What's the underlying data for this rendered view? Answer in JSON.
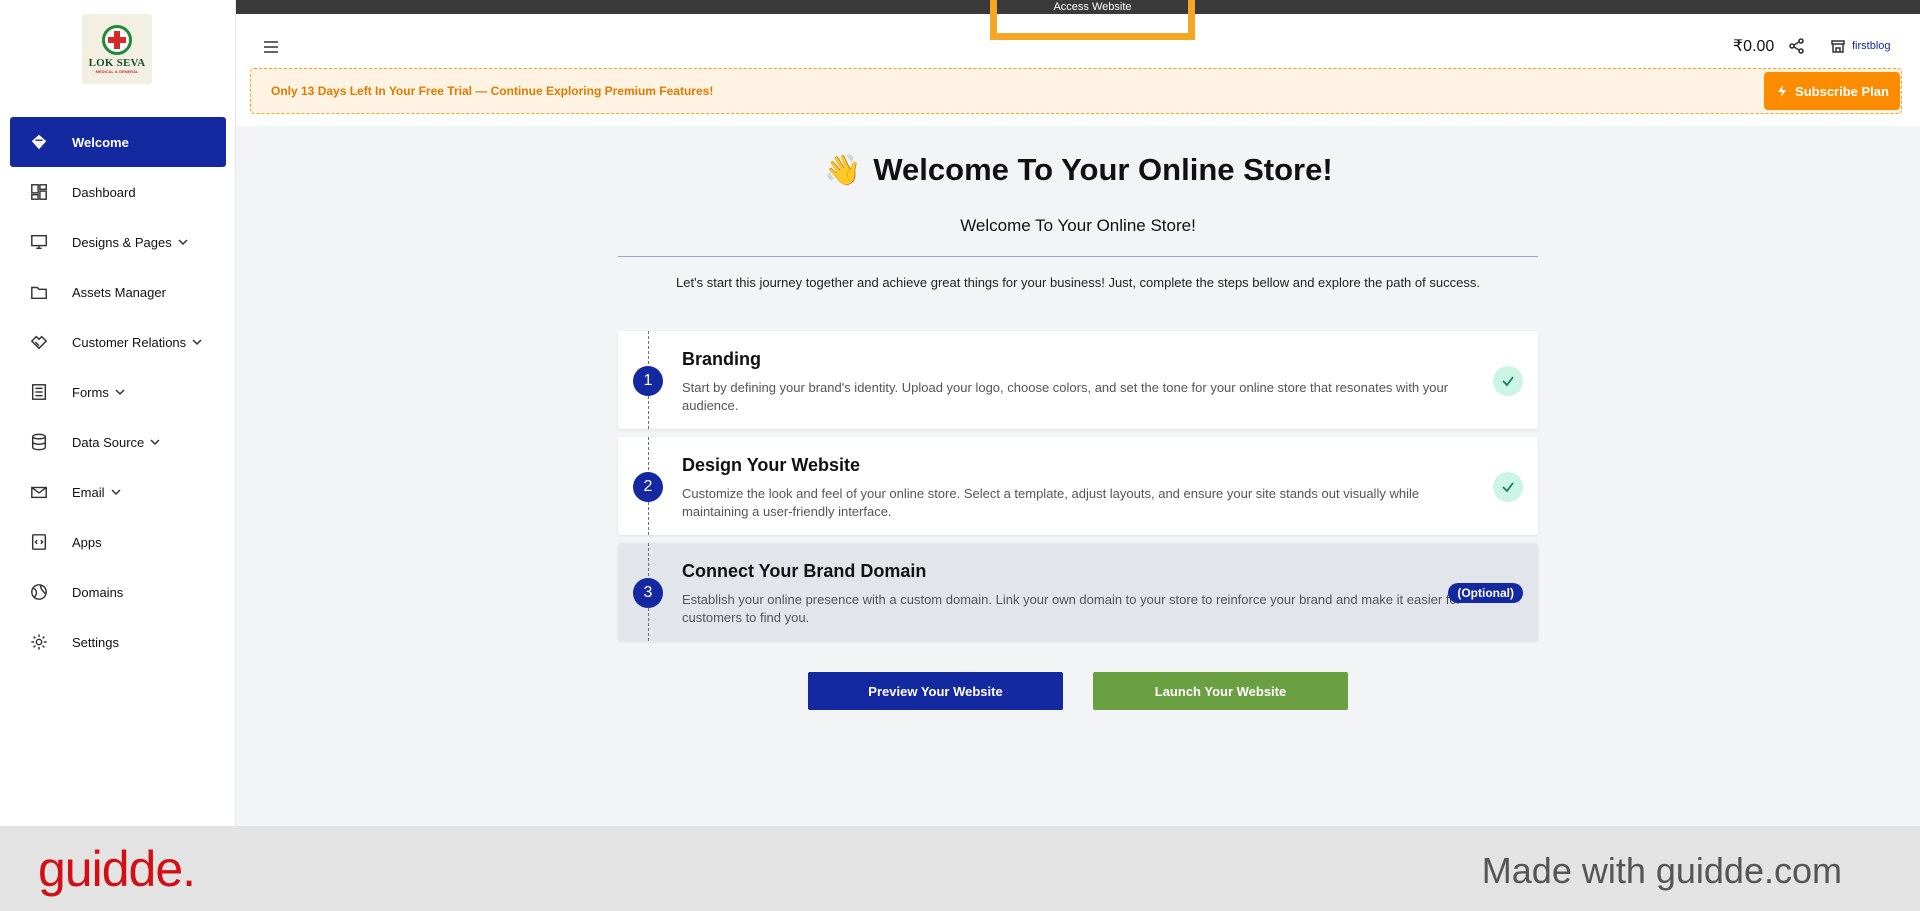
{
  "brand": {
    "logo_text": "LOK SEVA",
    "logo_subtext": "MEDICAL & GENERAL"
  },
  "sidebar": {
    "items": [
      {
        "label": "Welcome",
        "icon": "diamond-icon",
        "active": true,
        "has_chevron": false
      },
      {
        "label": "Dashboard",
        "icon": "dashboard-icon",
        "active": false,
        "has_chevron": false
      },
      {
        "label": "Designs & Pages",
        "icon": "monitor-icon",
        "active": false,
        "has_chevron": true
      },
      {
        "label": "Assets Manager",
        "icon": "folder-icon",
        "active": false,
        "has_chevron": false
      },
      {
        "label": "Customer Relations",
        "icon": "handshake-icon",
        "active": false,
        "has_chevron": true
      },
      {
        "label": "Forms",
        "icon": "form-icon",
        "active": false,
        "has_chevron": true
      },
      {
        "label": "Data Source",
        "icon": "database-icon",
        "active": false,
        "has_chevron": true
      },
      {
        "label": "Email",
        "icon": "mail-icon",
        "active": false,
        "has_chevron": true
      },
      {
        "label": "Apps",
        "icon": "apps-icon",
        "active": false,
        "has_chevron": false
      },
      {
        "label": "Domains",
        "icon": "globe-icon",
        "active": false,
        "has_chevron": false
      },
      {
        "label": "Settings",
        "icon": "gear-icon",
        "active": false,
        "has_chevron": false
      }
    ]
  },
  "header": {
    "access_website": "Access Website",
    "balance": "₹0.00",
    "store_name": "firstblog"
  },
  "trial": {
    "message": "Only 13 Days Left In Your Free Trial — Continue Exploring Premium Features!",
    "subscribe_label": "Subscribe Plan"
  },
  "main": {
    "title": "Welcome To Your Online Store!",
    "wave": "👋",
    "subtitle": "Welcome To Your Online Store!",
    "intro": "Let's start this journey together and achieve great things for your business! Just, complete the steps bellow and explore the path of success.",
    "steps": [
      {
        "number": "1",
        "title": "Branding",
        "description": "Start by defining your brand's identity. Upload your logo, choose colors, and set the tone for your online store that resonates with your audience.",
        "status": "done"
      },
      {
        "number": "2",
        "title": "Design Your Website",
        "description": "Customize the look and feel of your online store. Select a template, adjust layouts, and ensure your site stands out visually while maintaining a user-friendly interface.",
        "status": "done"
      },
      {
        "number": "3",
        "title": "Connect Your Brand Domain",
        "description": "Establish your online presence with a custom domain. Link your own domain to your store to reinforce your brand and make it easier for customers to find you.",
        "status": "optional",
        "badge": "(Optional)"
      }
    ],
    "preview_label": "Preview Your Website",
    "launch_label": "Launch Your Website"
  },
  "footer": {
    "logo": "guidde.",
    "made_with": "Made with guidde.com"
  },
  "colors": {
    "primary": "#1428a0",
    "accent": "#fb8c00",
    "launch": "#6aa042",
    "highlight": "#f5a623",
    "guidde_red": "#d20f15"
  }
}
